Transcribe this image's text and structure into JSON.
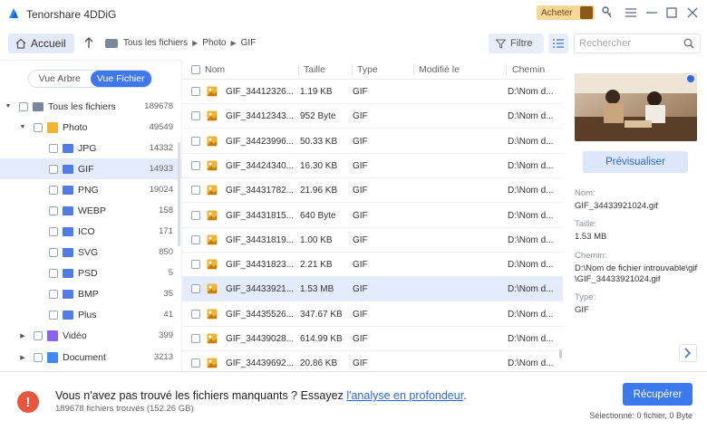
{
  "app": {
    "title": "Tenorshare 4DDiG",
    "buy_label": "Acheter"
  },
  "toolbar": {
    "home_label": "Accueil",
    "breadcrumb": [
      "Tous les fichiers",
      "Photo",
      "GIF"
    ],
    "filter_label": "Filtre",
    "search_placeholder": "Rechercher"
  },
  "tree": {
    "view_toggle": [
      "Vue Arbre",
      "Vue Fichier"
    ],
    "active_view": "Vue Fichier",
    "root": {
      "label": "Tous les fichiers",
      "count": "189678"
    },
    "photo": {
      "label": "Photo",
      "count": "49549"
    },
    "subfolders": [
      {
        "label": "JPG",
        "count": "14332"
      },
      {
        "label": "GIF",
        "count": "14933"
      },
      {
        "label": "PNG",
        "count": "19024"
      },
      {
        "label": "WEBP",
        "count": "158"
      },
      {
        "label": "ICO",
        "count": "171"
      },
      {
        "label": "SVG",
        "count": "850"
      },
      {
        "label": "PSD",
        "count": "5"
      },
      {
        "label": "BMP",
        "count": "35"
      },
      {
        "label": "Plus",
        "count": "41"
      }
    ],
    "video": {
      "label": "Vidéo",
      "count": "399"
    },
    "document": {
      "label": "Document",
      "count": "3213"
    }
  },
  "filelist": {
    "columns": [
      "Nom",
      "Taille",
      "Type",
      "Modifié le",
      "Chemin"
    ],
    "rows": [
      {
        "name": "GIF_34412326...",
        "size": "1.19 KB",
        "type": "GIF",
        "modified": "",
        "path": "D:\\Nom d..."
      },
      {
        "name": "GIF_34412343...",
        "size": "952 Byte",
        "type": "GIF",
        "modified": "",
        "path": "D:\\Nom d..."
      },
      {
        "name": "GIF_34423996...",
        "size": "50.33 KB",
        "type": "GIF",
        "modified": "",
        "path": "D:\\Nom d..."
      },
      {
        "name": "GIF_34424340...",
        "size": "16.30 KB",
        "type": "GIF",
        "modified": "",
        "path": "D:\\Nom d..."
      },
      {
        "name": "GIF_34431782...",
        "size": "21.96 KB",
        "type": "GIF",
        "modified": "",
        "path": "D:\\Nom d..."
      },
      {
        "name": "GIF_34431815...",
        "size": "640 Byte",
        "type": "GIF",
        "modified": "",
        "path": "D:\\Nom d..."
      },
      {
        "name": "GIF_34431819...",
        "size": "1.00 KB",
        "type": "GIF",
        "modified": "",
        "path": "D:\\Nom d..."
      },
      {
        "name": "GIF_34431823...",
        "size": "2.21 KB",
        "type": "GIF",
        "modified": "",
        "path": "D:\\Nom d..."
      },
      {
        "name": "GIF_34433921...",
        "size": "1.53 MB",
        "type": "GIF",
        "modified": "",
        "path": "D:\\Nom d..."
      },
      {
        "name": "GIF_34435526...",
        "size": "347.67 KB",
        "type": "GIF",
        "modified": "",
        "path": "D:\\Nom d..."
      },
      {
        "name": "GIF_34439028...",
        "size": "614.99 KB",
        "type": "GIF",
        "modified": "",
        "path": "D:\\Nom d..."
      },
      {
        "name": "GIF_34439692...",
        "size": "20.86 KB",
        "type": "GIF",
        "modified": "",
        "path": "D:\\Nom d..."
      }
    ],
    "selected_index": 8
  },
  "preview": {
    "button_label": "Prévisualiser",
    "name_label": "Nom:",
    "name_value": "GIF_34433921024.gif",
    "size_label": "Taille:",
    "size_value": "1.53 MB",
    "path_label": "Chemin:",
    "path_value": "D:\\Nom de fichier introuvable\\gif\\GIF_34433921024.gif",
    "type_label": "Type:",
    "type_value": "GIF"
  },
  "footer": {
    "message_prefix": "Vous n'avez pas trouvé les fichiers manquants ? Essayez ",
    "message_link": "l'analyse en profondeur",
    "message_suffix": ".",
    "sub": "189678 fichiers trouvés (152.26 GB)",
    "recover_label": "Récupérer",
    "selection_info": "Sélectionné: 0 fichier, 0 Byte"
  },
  "colors": {
    "accent": "#3b79ec",
    "selected_row": "#e4ecfb",
    "warning": "#e8563f",
    "folder": "#4f7ce8",
    "gif_icon": "#f2b233"
  }
}
